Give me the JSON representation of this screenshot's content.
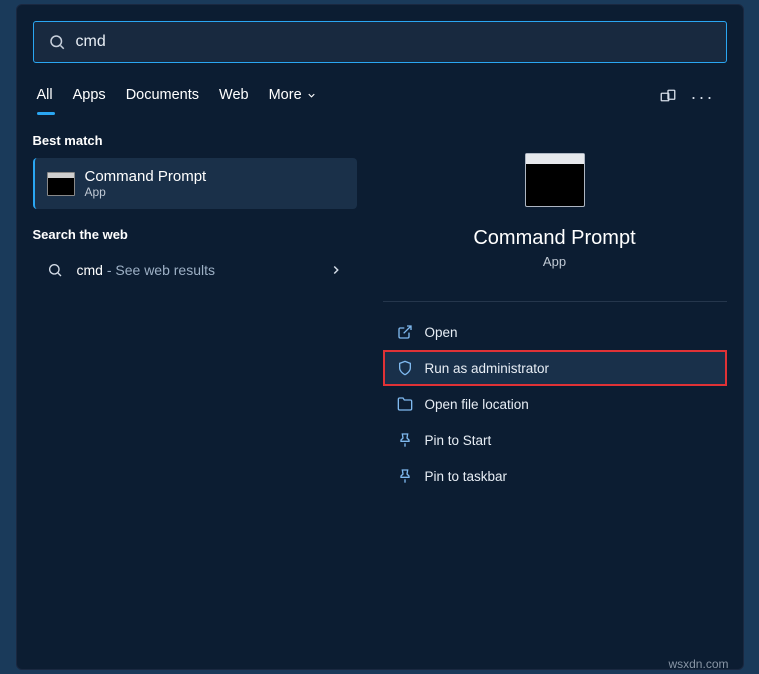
{
  "search": {
    "value": "cmd"
  },
  "tabs": {
    "items": [
      "All",
      "Apps",
      "Documents",
      "Web",
      "More"
    ],
    "activeIndex": 0
  },
  "sections": {
    "bestMatch": "Best match",
    "searchWeb": "Search the web"
  },
  "bestMatch": {
    "title": "Command Prompt",
    "subtitle": "App"
  },
  "web": {
    "query": "cmd",
    "suffix": " - See web results"
  },
  "preview": {
    "title": "Command Prompt",
    "subtitle": "App"
  },
  "actions": {
    "open": "Open",
    "runAdmin": "Run as administrator",
    "openLoc": "Open file location",
    "pinStart": "Pin to Start",
    "pinTaskbar": "Pin to taskbar"
  },
  "watermark": "wsxdn.com"
}
